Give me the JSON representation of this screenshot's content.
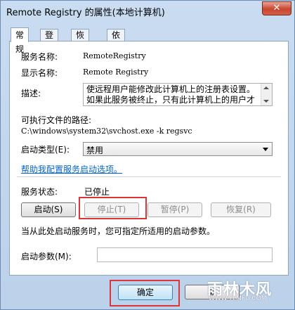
{
  "window": {
    "title": "Remote Registry 的属性(本地计算机)",
    "close_glyph": "✕"
  },
  "tabs": [
    {
      "label": "常规"
    },
    {
      "label": "登录"
    },
    {
      "label": "恢复"
    },
    {
      "label": "依存关系"
    }
  ],
  "general": {
    "service_name_label": "服务名称:",
    "service_name_value": "RemoteRegistry",
    "display_name_label": "显示名称:",
    "display_name_value": "Remote Registry",
    "description_label": "描述:",
    "description_value": "使远程用户能修改此计算机上的注册表设置。如果此服务被终止，只有此计算机上的用户才",
    "exe_path_label": "可执行文件的路径:",
    "exe_path_value": "C:\\windows\\system32\\svchost.exe -k regsvc",
    "startup_type_label": "启动类型(E):",
    "startup_type_value": "禁用",
    "help_link": "帮助我配置服务启动选项。",
    "status_label": "服务状态:",
    "status_value": "已停止",
    "start_button": "启动(S)",
    "stop_button": "停止(T)",
    "pause_button": "暂停(P)",
    "resume_button": "恢复(R)",
    "hint": "当从此处启动服务时，您可指定所适用的启动参数。",
    "params_label": "启动参数(M):",
    "params_value": ""
  },
  "footer": {
    "ok_button": "确定",
    "cancel_button": "取"
  },
  "watermark": {
    "text": "雨林木风",
    "url": "WWW.YLMFU.COM"
  }
}
